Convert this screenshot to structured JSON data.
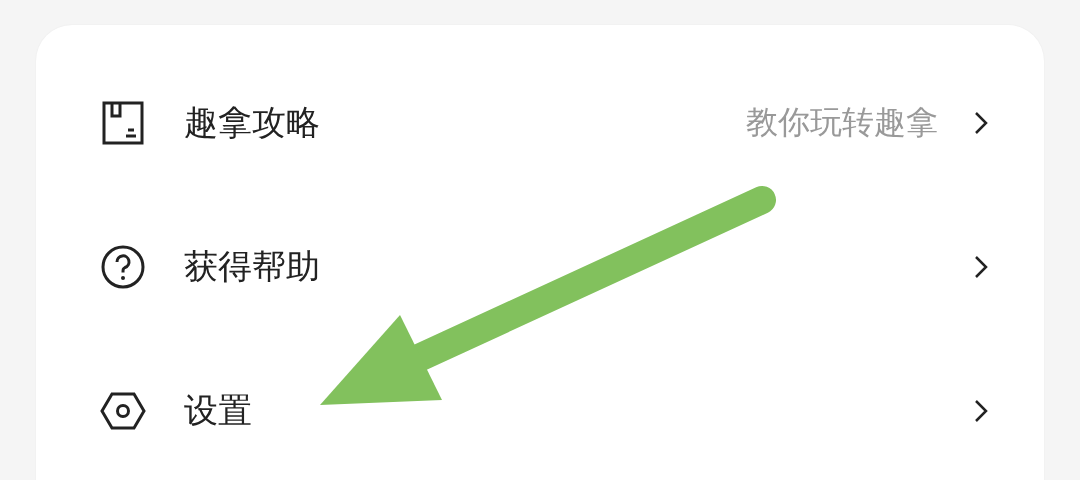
{
  "menu": {
    "items": [
      {
        "label": "趣拿攻略",
        "hint": "教你玩转趣拿"
      },
      {
        "label": "获得帮助"
      },
      {
        "label": "设置"
      }
    ]
  }
}
